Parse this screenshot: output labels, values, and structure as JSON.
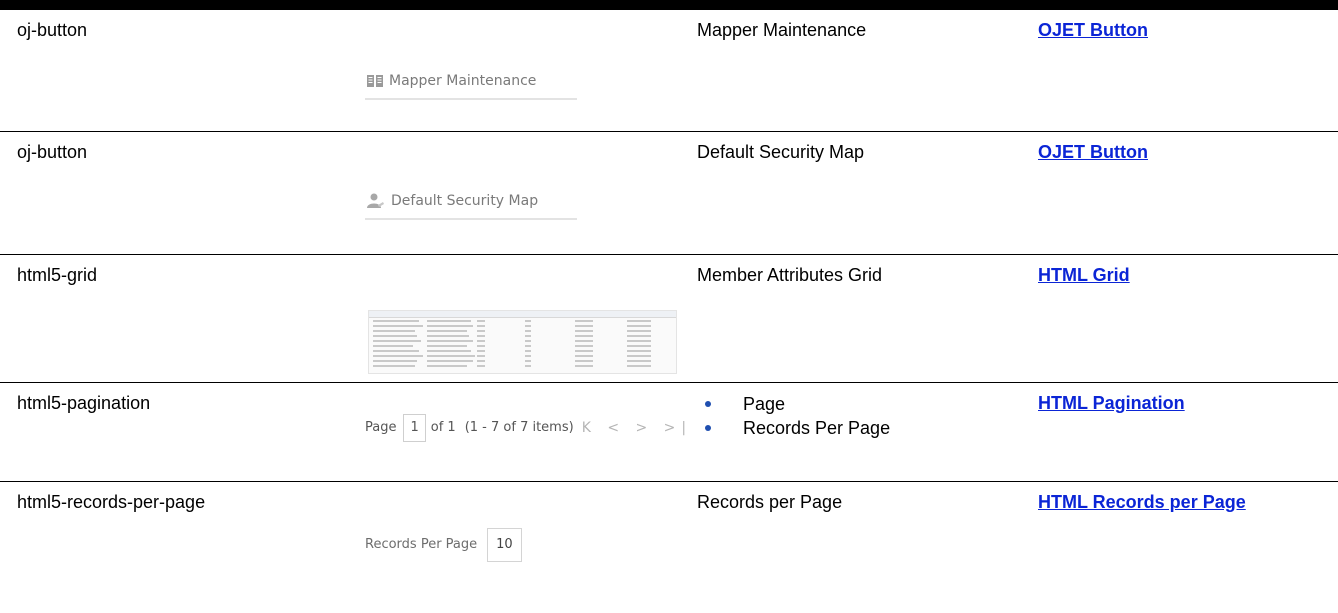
{
  "rows": [
    {
      "type_name": "oj-button",
      "image": {
        "kind": "button",
        "icon": "book-icon",
        "label": "Mapper Maintenance"
      },
      "description": "Mapper Maintenance",
      "link": "OJET Button"
    },
    {
      "type_name": "oj-button",
      "image": {
        "kind": "button",
        "icon": "user-icon",
        "label": "Default Security Map"
      },
      "description": "Default Security Map",
      "link": "OJET Button"
    },
    {
      "type_name": "html5-grid",
      "image": {
        "kind": "grid-thumbnail"
      },
      "description": "Member Attributes Grid",
      "link": "HTML Grid"
    },
    {
      "type_name": "html5-pagination",
      "image": {
        "kind": "pagination",
        "page_label": "Page",
        "page_value": "1",
        "of_text": "of 1",
        "items_text": "(1 - 7 of  7  items)",
        "nav_glyphs": "K < > >|"
      },
      "description_items": [
        "Page",
        "Records Per Page"
      ],
      "link": "HTML Pagination"
    },
    {
      "type_name": "html5-records-per-page",
      "image": {
        "kind": "records-per-page",
        "label": "Records Per Page",
        "value": "10"
      },
      "description": "Records per Page",
      "link": "HTML Records per Page"
    }
  ],
  "colors": {
    "link": "#0b25d6",
    "bullet": "#1f4fb0",
    "top_bar": "#000000"
  }
}
